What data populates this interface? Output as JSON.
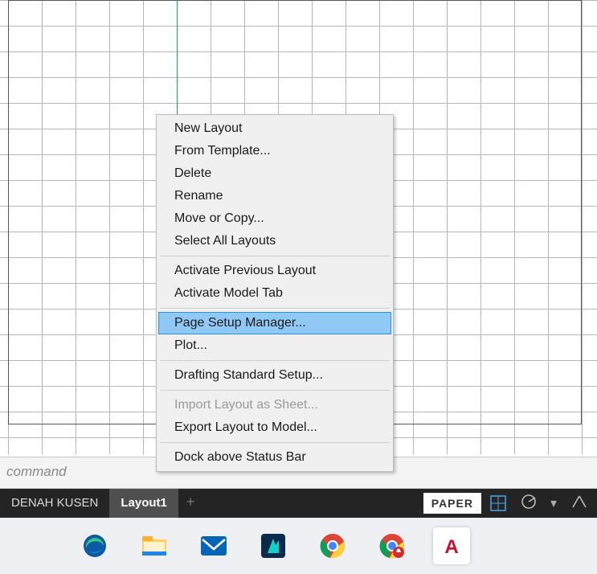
{
  "commandBar": {
    "placeholder": "command"
  },
  "tabs": {
    "items": [
      {
        "label": "DENAH KUSEN",
        "active": false
      },
      {
        "label": "Layout1",
        "active": true
      }
    ],
    "add": "+"
  },
  "status": {
    "paper": "PAPER",
    "caret": "▾"
  },
  "contextMenu": {
    "items": [
      {
        "label": "New Layout",
        "type": "item"
      },
      {
        "label": "From Template...",
        "type": "item"
      },
      {
        "label": "Delete",
        "type": "item"
      },
      {
        "label": "Rename",
        "type": "item"
      },
      {
        "label": "Move or Copy...",
        "type": "item"
      },
      {
        "label": "Select All Layouts",
        "type": "item"
      },
      {
        "type": "sep"
      },
      {
        "label": "Activate Previous Layout",
        "type": "item"
      },
      {
        "label": "Activate Model Tab",
        "type": "item"
      },
      {
        "type": "sep"
      },
      {
        "label": "Page Setup Manager...",
        "type": "item",
        "highlight": true
      },
      {
        "label": "Plot...",
        "type": "item"
      },
      {
        "type": "sep"
      },
      {
        "label": "Drafting Standard Setup...",
        "type": "item"
      },
      {
        "type": "sep"
      },
      {
        "label": "Import Layout as Sheet...",
        "type": "item",
        "disabled": true
      },
      {
        "label": "Export Layout to Model...",
        "type": "item"
      },
      {
        "type": "sep"
      },
      {
        "label": "Dock above Status Bar",
        "type": "item"
      }
    ]
  },
  "taskbarApps": [
    {
      "name": "edge"
    },
    {
      "name": "explorer"
    },
    {
      "name": "mail"
    },
    {
      "name": "filmora"
    },
    {
      "name": "chrome"
    },
    {
      "name": "chrome-alt"
    },
    {
      "name": "autocad",
      "active": true
    }
  ]
}
